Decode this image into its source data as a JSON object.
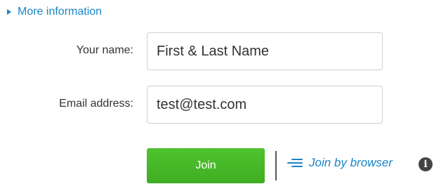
{
  "more_info": {
    "icon": "caret-right-icon",
    "label": "More information"
  },
  "form": {
    "name": {
      "label": "Your name:",
      "value": "First & Last Name"
    },
    "email": {
      "label": "Email address:",
      "value": "test@test.com"
    }
  },
  "actions": {
    "join_label": "Join",
    "join_browser_icon": "lines-icon",
    "join_browser_label": "Join by browser",
    "info_icon": "info-icon",
    "info_glyph": "i"
  },
  "colors": {
    "link": "#1b85c5",
    "join_button": "#43b526",
    "info_icon": "#444444"
  }
}
